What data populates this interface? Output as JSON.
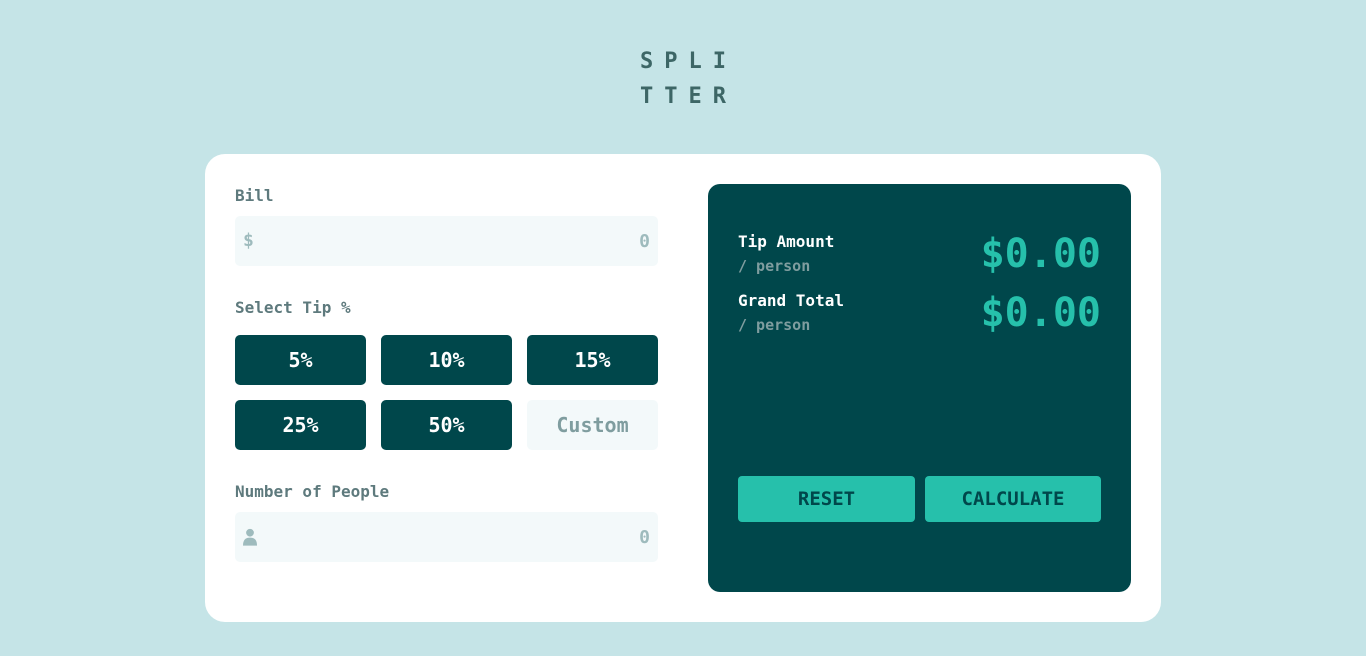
{
  "app": {
    "logo_line1": "SPLI",
    "logo_line2": "TTER"
  },
  "bill": {
    "label": "Bill",
    "prefix": "$",
    "placeholder": "0",
    "value": ""
  },
  "tip": {
    "label": "Select Tip %",
    "options": [
      "5%",
      "10%",
      "15%",
      "25%",
      "50%"
    ],
    "custom_placeholder": "Custom"
  },
  "people": {
    "label": "Number of People",
    "placeholder": "0",
    "value": "",
    "icon": "person-icon"
  },
  "results": {
    "tip_amount_label": "Tip Amount",
    "tip_amount_sub": "/ person",
    "tip_amount_value": "$0.00",
    "total_label": "Grand Total",
    "total_sub": "/ person",
    "total_value": "$0.00"
  },
  "actions": {
    "reset_label": "RESET",
    "calculate_label": "CALCULATE"
  },
  "colors": {
    "background": "#c5e4e7",
    "dark_cyan": "#00474b",
    "strong_cyan": "#26c0ab",
    "input_bg": "#f3f9fa",
    "label_gray": "#5e7a7d"
  }
}
